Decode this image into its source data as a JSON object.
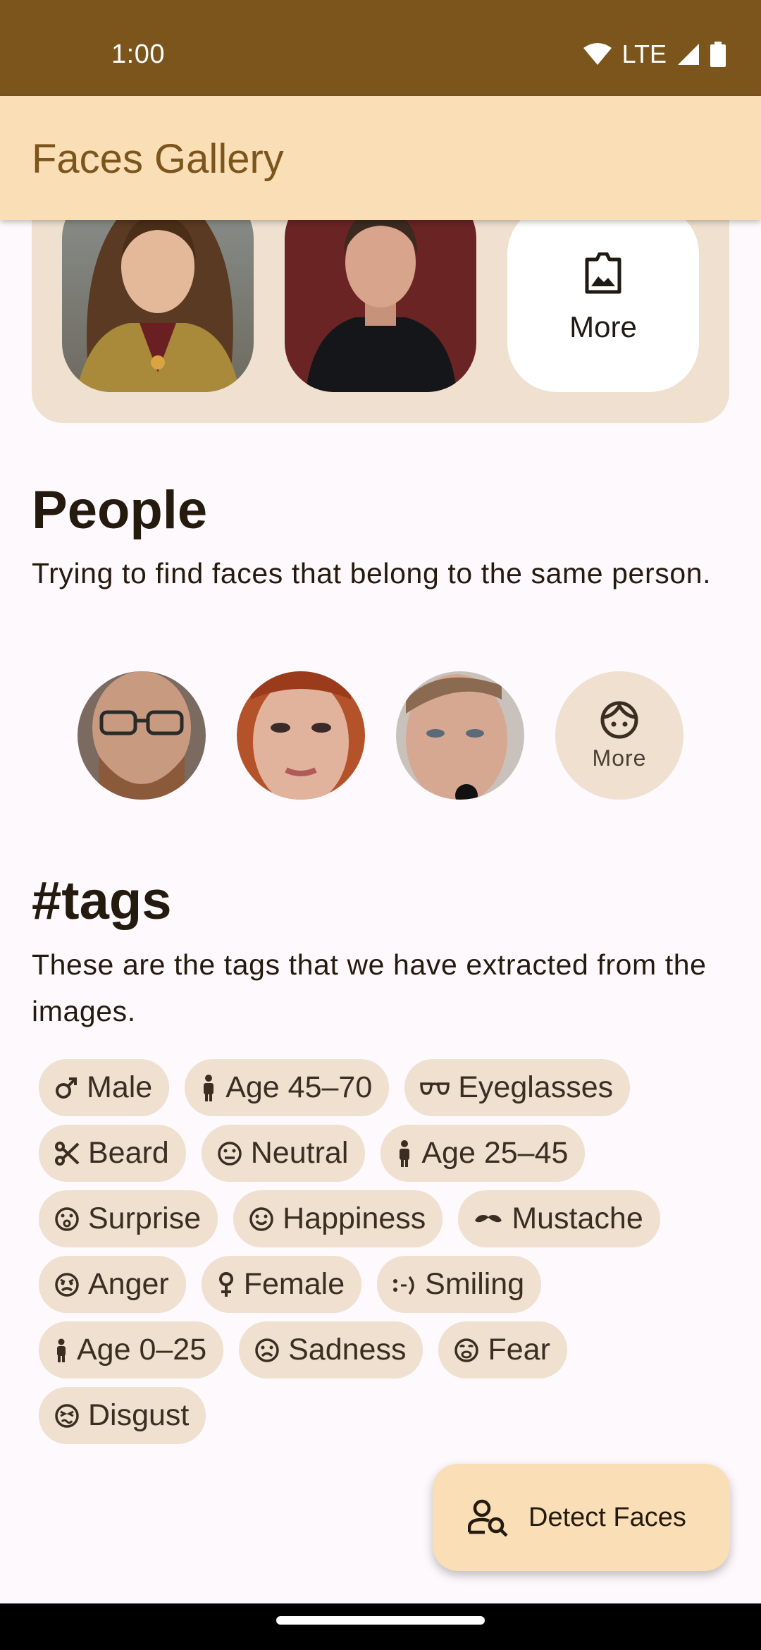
{
  "status_bar": {
    "time": "1:00",
    "network": "LTE"
  },
  "app_bar": {
    "title": "Faces Gallery"
  },
  "gallery": {
    "more_label": "More"
  },
  "people": {
    "title": "People",
    "description": "Trying to find faces that belong to the same person.",
    "more_label": "More"
  },
  "tags": {
    "title": "#tags",
    "description": "These are the tags that we have extracted from the images.",
    "items": [
      {
        "label": "Male",
        "icon": "male-icon"
      },
      {
        "label": "Age 45–70",
        "icon": "person-icon"
      },
      {
        "label": "Eyeglasses",
        "icon": "eyeglasses-icon"
      },
      {
        "label": "Beard",
        "icon": "scissors-icon"
      },
      {
        "label": "Neutral",
        "icon": "neutral-face-icon"
      },
      {
        "label": "Age 25–45",
        "icon": "person-icon"
      },
      {
        "label": "Surprise",
        "icon": "surprise-face-icon"
      },
      {
        "label": "Happiness",
        "icon": "happy-face-icon"
      },
      {
        "label": "Mustache",
        "icon": "mustache-icon"
      },
      {
        "label": "Anger",
        "icon": "angry-face-icon"
      },
      {
        "label": "Female",
        "icon": "female-icon"
      },
      {
        "label": "Smiling",
        "icon": "smiling-icon"
      },
      {
        "label": "Age 0–25",
        "icon": "child-icon"
      },
      {
        "label": "Sadness",
        "icon": "sad-face-icon"
      },
      {
        "label": "Fear",
        "icon": "fear-face-icon"
      },
      {
        "label": "Disgust",
        "icon": "disgust-face-icon"
      }
    ]
  },
  "fab": {
    "label": "Detect Faces",
    "icon": "person-search-icon"
  },
  "colors": {
    "status_bar": "#7b551c",
    "app_bar": "#f9deb6",
    "chip": "#efe0d0",
    "background": "#fdf9fc"
  }
}
